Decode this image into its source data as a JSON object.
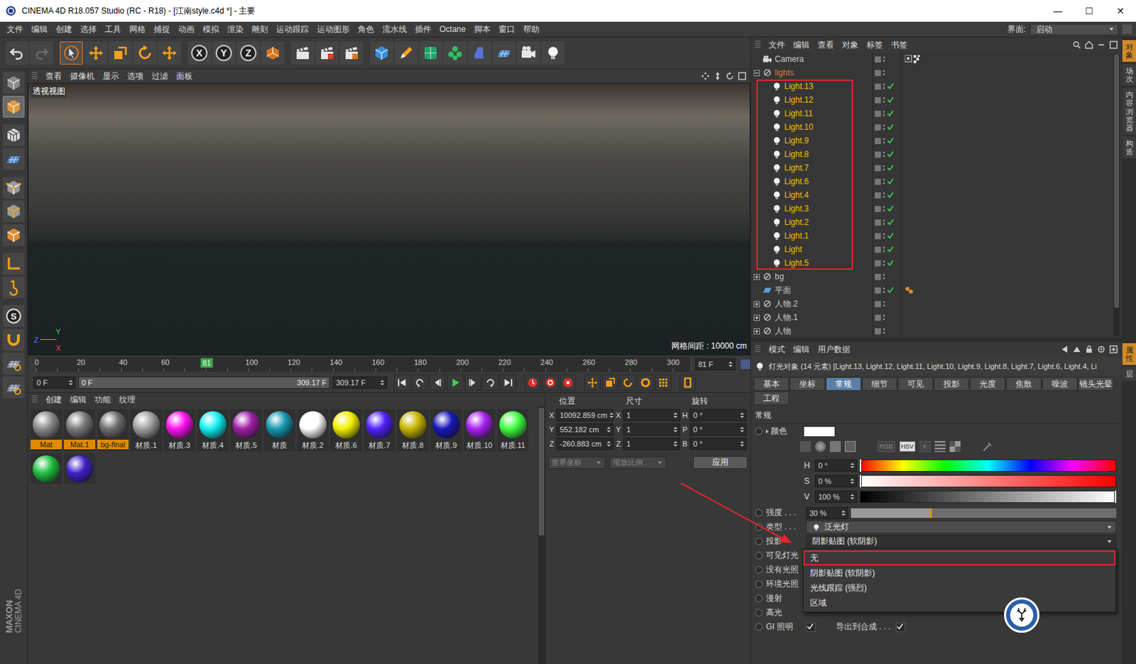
{
  "window": {
    "title": "CINEMA 4D R18.057 Studio (RC - R18) - [江南style.c4d *] - 主要",
    "controls": [
      "—",
      "☐",
      "✕"
    ]
  },
  "menu": [
    "文件",
    "编辑",
    "创建",
    "选择",
    "工具",
    "网格",
    "捕捉",
    "动画",
    "模拟",
    "渲染",
    "雕刻",
    "运动跟踪",
    "运动图形",
    "角色",
    "流水线",
    "插件",
    "Octane",
    "脚本",
    "窗口",
    "帮助"
  ],
  "layout": {
    "label": "界面:",
    "value": "启动"
  },
  "toolbar": [
    {
      "kind": "undo",
      "label": "",
      "selected": false
    },
    {
      "kind": "redo",
      "label": "",
      "selected": false
    },
    {
      "kind": "select",
      "label": "",
      "selected": true
    },
    {
      "kind": "move",
      "label": "",
      "selected": false
    },
    {
      "kind": "scale",
      "label": "",
      "selected": false
    },
    {
      "kind": "rotate",
      "label": "",
      "selected": false
    },
    {
      "kind": "place",
      "label": "",
      "selected": false
    },
    {
      "kind": "axis",
      "label": "X",
      "selected": false
    },
    {
      "kind": "axis",
      "label": "Y",
      "selected": false
    },
    {
      "kind": "axis",
      "label": "Z",
      "selected": false
    },
    {
      "kind": "coord",
      "label": "",
      "selected": false
    },
    {
      "kind": "render",
      "label": "",
      "selected": false
    },
    {
      "kind": "render-view",
      "label": "",
      "selected": false
    },
    {
      "kind": "render-settings",
      "label": "",
      "selected": false
    },
    {
      "kind": "cube",
      "label": "",
      "selected": false
    },
    {
      "kind": "pen",
      "label": "",
      "selected": false
    },
    {
      "kind": "subdiv",
      "label": "",
      "selected": false
    },
    {
      "kind": "cloner",
      "label": "",
      "selected": false
    },
    {
      "kind": "deform",
      "label": "",
      "selected": false
    },
    {
      "kind": "floor",
      "label": "",
      "selected": false
    },
    {
      "kind": "camera",
      "label": "",
      "selected": false
    },
    {
      "kind": "light",
      "label": "",
      "selected": false
    }
  ],
  "left_tools": [
    {
      "kind": "editable",
      "label": "",
      "selected": false
    },
    {
      "kind": "model",
      "label": "",
      "selected": true
    },
    {
      "kind": "texture",
      "label": "",
      "selected": false
    },
    {
      "kind": "workplane",
      "label": "",
      "selected": false
    },
    {
      "kind": "points",
      "label": "",
      "selected": false
    },
    {
      "kind": "edges",
      "label": "",
      "selected": false
    },
    {
      "kind": "polys",
      "label": "",
      "selected": false
    },
    {
      "kind": "axis-mode",
      "label": "",
      "selected": false
    },
    {
      "kind": "tweak",
      "label": "",
      "selected": false
    },
    {
      "kind": "snap",
      "label": "S",
      "selected": false
    },
    {
      "kind": "magnet",
      "label": "",
      "selected": false
    },
    {
      "kind": "grid-lock",
      "label": "",
      "selected": false
    },
    {
      "kind": "grid-flip",
      "label": "",
      "selected": false
    }
  ],
  "brand": [
    "MAXON",
    "CINEMA 4D"
  ],
  "viewport": {
    "menu": [
      "查看",
      "摄像机",
      "显示",
      "选项",
      "过滤",
      "面板"
    ],
    "label": "透视视图",
    "grid": "网格间距 : 10000 cm",
    "axis": [
      "Y",
      "Z",
      "X"
    ]
  },
  "timeline": {
    "ticks": [
      "0",
      "20",
      "40",
      "60",
      "100",
      "120",
      "140",
      "160",
      "180",
      "200",
      "220",
      "240",
      "260",
      "280",
      "300"
    ],
    "marker": {
      "label": "81",
      "level": 0.2613
    },
    "frame": "81 F",
    "start": "0 F",
    "range_start": "0 F",
    "range_end": "309.17 F",
    "end": "309.17 F"
  },
  "playback": [
    {
      "kind": "to-start"
    },
    {
      "kind": "prev-key"
    },
    {
      "kind": "prev-frame"
    },
    {
      "kind": "play"
    },
    {
      "kind": "next-frame"
    },
    {
      "kind": "next-key"
    },
    {
      "kind": "to-end"
    },
    {
      "kind": "record"
    },
    {
      "kind": "auto-key"
    },
    {
      "kind": "key-help"
    },
    {
      "kind": "key-move"
    },
    {
      "kind": "key-scale"
    },
    {
      "kind": "key-rotate"
    },
    {
      "kind": "key-param"
    },
    {
      "kind": "key-pla"
    },
    {
      "kind": "timeline-window"
    }
  ],
  "materials": {
    "menu": [
      "创建",
      "编辑",
      "功能",
      "纹理"
    ],
    "items": [
      {
        "name": "Mat",
        "color": "#8a8a8a",
        "selected": true
      },
      {
        "name": "Mat.1",
        "color": "#7c7c7c",
        "selected": true
      },
      {
        "name": "bg-final",
        "color": "#6e6e6e",
        "selected": true
      },
      {
        "name": "材质.1",
        "color": "#a0a0a0",
        "selected": false
      },
      {
        "name": "材质.3",
        "color": "#ff10f0",
        "selected": false
      },
      {
        "name": "材质.4",
        "color": "#10f0f0",
        "selected": false
      },
      {
        "name": "材质.5",
        "color": "#a020a8",
        "selected": false
      },
      {
        "name": "材质",
        "color": "#1898b0",
        "selected": false
      },
      {
        "name": "材质.2",
        "color": "#ffffff",
        "selected": false
      },
      {
        "name": "材质.6",
        "color": "#f4f000",
        "selected": false
      },
      {
        "name": "材质.7",
        "color": "#5020ff",
        "selected": false
      },
      {
        "name": "材质.8",
        "color": "#c8b400",
        "selected": false
      },
      {
        "name": "材质.9",
        "color": "#1818b8",
        "selected": false
      },
      {
        "name": "材质.10",
        "color": "#a820f0",
        "selected": false
      },
      {
        "name": "材质.11",
        "color": "#40ff40",
        "selected": false
      },
      {
        "name": "",
        "color": "#20c040",
        "selected": false
      },
      {
        "name": "",
        "color": "#4020c8",
        "selected": false
      }
    ]
  },
  "coordinates": {
    "headers": [
      "位置",
      "尺寸",
      "旋转"
    ],
    "rows": [
      {
        "axis": "X",
        "position": "10092.859 cm",
        "size_axis": "X",
        "size": "1",
        "rot_axis": "H",
        "rotation": "0 °"
      },
      {
        "axis": "Y",
        "position": "552.182 cm",
        "size_axis": "Y",
        "size": "1",
        "rot_axis": "P",
        "rotation": "0 °"
      },
      {
        "axis": "Z",
        "position": "-260.883 cm",
        "size_axis": "Z",
        "size": "1",
        "rot_axis": "B",
        "rotation": "0 °"
      }
    ],
    "mode": "世界坐标",
    "scale": "缩放比例",
    "apply": "应用"
  },
  "objects": {
    "menu": [
      "文件",
      "编辑",
      "查看",
      "对象",
      "标签",
      "书签"
    ],
    "rows": [
      {
        "name": "Camera",
        "depth": 0,
        "kind": "camera",
        "expandable": false,
        "expanded": false,
        "selected": false,
        "enabled": false,
        "tag": "target",
        "annotated": false,
        "color": "#c8c8c8"
      },
      {
        "name": "lights",
        "depth": 0,
        "kind": "null",
        "expandable": true,
        "expanded": true,
        "selected": false,
        "enabled": false,
        "tag": "",
        "annotated": false,
        "color": "#c9823a"
      },
      {
        "name": "Light.13",
        "depth": 1,
        "kind": "light",
        "expandable": false,
        "expanded": false,
        "selected": true,
        "enabled": true,
        "tag": "",
        "annotated": true,
        "color": "#f2c200"
      },
      {
        "name": "Light.12",
        "depth": 1,
        "kind": "light",
        "expandable": false,
        "expanded": false,
        "selected": true,
        "enabled": true,
        "tag": "",
        "annotated": true,
        "color": "#f2c200"
      },
      {
        "name": "Light.11",
        "depth": 1,
        "kind": "light",
        "expandable": false,
        "expanded": false,
        "selected": true,
        "enabled": true,
        "tag": "",
        "annotated": true,
        "color": "#f2c200"
      },
      {
        "name": "Light.10",
        "depth": 1,
        "kind": "light",
        "expandable": false,
        "expanded": false,
        "selected": true,
        "enabled": true,
        "tag": "",
        "annotated": true,
        "color": "#f2c200"
      },
      {
        "name": "Light.9",
        "depth": 1,
        "kind": "light",
        "expandable": false,
        "expanded": false,
        "selected": true,
        "enabled": true,
        "tag": "",
        "annotated": true,
        "color": "#f2c200"
      },
      {
        "name": "Light.8",
        "depth": 1,
        "kind": "light",
        "expandable": false,
        "expanded": false,
        "selected": true,
        "enabled": true,
        "tag": "",
        "annotated": true,
        "color": "#f2c200"
      },
      {
        "name": "Light.7",
        "depth": 1,
        "kind": "light",
        "expandable": false,
        "expanded": false,
        "selected": true,
        "enabled": true,
        "tag": "",
        "annotated": true,
        "color": "#f2c200"
      },
      {
        "name": "Light.6",
        "depth": 1,
        "kind": "light",
        "expandable": false,
        "expanded": false,
        "selected": true,
        "enabled": true,
        "tag": "",
        "annotated": true,
        "color": "#f2c200"
      },
      {
        "name": "Light.4",
        "depth": 1,
        "kind": "light",
        "expandable": false,
        "expanded": false,
        "selected": true,
        "enabled": true,
        "tag": "",
        "annotated": true,
        "color": "#f2c200"
      },
      {
        "name": "Light.3",
        "depth": 1,
        "kind": "light",
        "expandable": false,
        "expanded": false,
        "selected": true,
        "enabled": true,
        "tag": "",
        "annotated": true,
        "color": "#f2c200"
      },
      {
        "name": "Light.2",
        "depth": 1,
        "kind": "light",
        "expandable": false,
        "expanded": false,
        "selected": true,
        "enabled": true,
        "tag": "",
        "annotated": true,
        "color": "#f2c200"
      },
      {
        "name": "Light.1",
        "depth": 1,
        "kind": "light",
        "expandable": false,
        "expanded": false,
        "selected": true,
        "enabled": true,
        "tag": "",
        "annotated": true,
        "color": "#f2c200"
      },
      {
        "name": "Light",
        "depth": 1,
        "kind": "light",
        "expandable": false,
        "expanded": false,
        "selected": true,
        "enabled": true,
        "tag": "",
        "annotated": true,
        "color": "#f2c200"
      },
      {
        "name": "Light.5",
        "depth": 1,
        "kind": "light",
        "expandable": false,
        "expanded": false,
        "selected": true,
        "enabled": true,
        "tag": "",
        "annotated": true,
        "color": "#f2c200"
      },
      {
        "name": "bg",
        "depth": 0,
        "kind": "null",
        "expandable": true,
        "expanded": false,
        "selected": false,
        "enabled": false,
        "tag": "",
        "annotated": false,
        "color": "#c8c8c8"
      },
      {
        "name": "平面",
        "depth": 0,
        "kind": "plane",
        "expandable": false,
        "expanded": false,
        "selected": false,
        "enabled": true,
        "tag": "material",
        "annotated": false,
        "color": "#c8c8c8"
      },
      {
        "name": "人物.2",
        "depth": 0,
        "kind": "null",
        "expandable": true,
        "expanded": false,
        "selected": false,
        "enabled": false,
        "tag": "",
        "annotated": false,
        "color": "#c8c8c8"
      },
      {
        "name": "人物.1",
        "depth": 0,
        "kind": "null",
        "expandable": true,
        "expanded": false,
        "selected": false,
        "enabled": false,
        "tag": "",
        "annotated": false,
        "color": "#c8c8c8"
      },
      {
        "name": "人物",
        "depth": 0,
        "kind": "null",
        "expandable": true,
        "expanded": false,
        "selected": false,
        "enabled": false,
        "tag": "",
        "annotated": false,
        "color": "#c8c8c8"
      }
    ]
  },
  "attributes": {
    "menu": [
      "模式",
      "编辑",
      "用户数据"
    ],
    "header": "灯光对象 (14 元素) [Light.13, Light.12, Light.11, Light.10, Light.9, Light.8, Light.7, Light.6, Light.4, Li",
    "tabs": [
      {
        "label": "基本",
        "selected": false
      },
      {
        "label": "坐标",
        "selected": false
      },
      {
        "label": "常规",
        "selected": true
      },
      {
        "label": "细节",
        "selected": false
      },
      {
        "label": "可见",
        "selected": false
      },
      {
        "label": "投影",
        "selected": false
      },
      {
        "label": "光度",
        "selected": false
      },
      {
        "label": "焦散",
        "selected": false
      },
      {
        "label": "噪波",
        "selected": false
      },
      {
        "label": "镜头光晕",
        "selected": false
      },
      {
        "label": "工程",
        "selected": false
      }
    ],
    "section": "常规",
    "color_label": "颜色",
    "color_value": "#ffffff",
    "color_modes": [
      {
        "label": "RGB",
        "selected": false
      },
      {
        "label": "HSV",
        "selected": true
      },
      {
        "label": "K",
        "selected": false
      }
    ],
    "hsv": [
      {
        "label": "H",
        "value": "0 °",
        "level": 0
      },
      {
        "label": "S",
        "value": "0 %",
        "level": 0
      },
      {
        "label": "V",
        "value": "100 %",
        "level": 1
      }
    ],
    "intensity": {
      "label": "强度 . . .",
      "value": "30 %",
      "level": 0.3
    },
    "type": {
      "label": "类型 . . .",
      "value": "泛光灯"
    },
    "shadow": {
      "label": "投影",
      "value": "阴影贴图 (软阴影)",
      "open": true,
      "options": [
        {
          "label": "无",
          "outlined": true
        },
        {
          "label": "阴影贴图 (软阴影)",
          "outlined": false
        },
        {
          "label": "光线跟踪 (强烈)",
          "outlined": false
        },
        {
          "label": "区域",
          "outlined": false
        }
      ]
    },
    "checks": [
      {
        "label": "可见灯光"
      },
      {
        "label": "没有光照"
      },
      {
        "label": "环境光照"
      },
      {
        "label": "漫射"
      },
      {
        "label": "高光"
      },
      {
        "label": "GI 照明",
        "checked": true,
        "extra": {
          "label": "导出到合成 . . .",
          "checked": true
        }
      }
    ]
  },
  "side_tabs": {
    "top": [
      {
        "label": "对象",
        "selected": true
      },
      {
        "label": "场次",
        "selected": false
      },
      {
        "label": "内容浏览器",
        "selected": false
      },
      {
        "label": "构造",
        "selected": false
      }
    ],
    "bottom": [
      {
        "label": "属性",
        "selected": true
      },
      {
        "label": "层",
        "selected": false
      }
    ]
  }
}
